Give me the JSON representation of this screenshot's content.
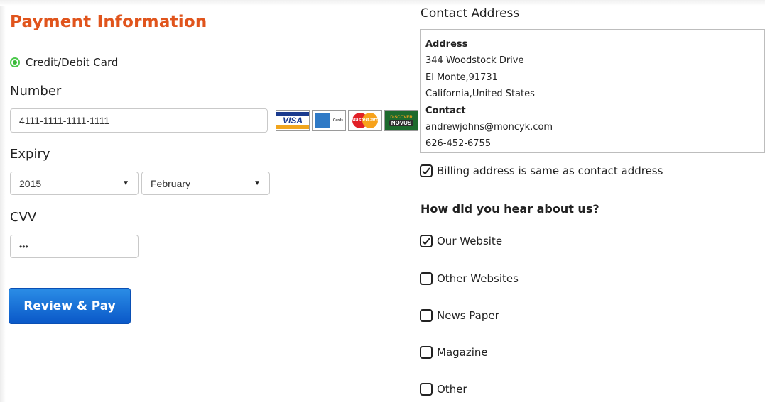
{
  "payment": {
    "title": "Payment Information",
    "method_label": "Credit/Debit Card",
    "number_label": "Number",
    "number_value": "4111-1111-1111-1111",
    "expiry_label": "Expiry",
    "expiry_year": "2015",
    "expiry_month": "February",
    "cvv_label": "CVV",
    "cvv_value": "•••",
    "submit_label": "Review & Pay",
    "card_logos": {
      "visa": "VISA",
      "mastercard": "MasterCard",
      "discover_top": "DISCOVER",
      "discover_bottom": "NOVUS",
      "amex_small": "Cards"
    }
  },
  "contact": {
    "title": "Contact Address",
    "address_heading": "Address",
    "address_lines": [
      "344 Woodstock Drive",
      "El Monte,91731",
      "California,United States"
    ],
    "contact_heading": "Contact",
    "email": "andrewjohns@moncyk.com",
    "phone": "626-452-6755"
  },
  "billing_same": {
    "label": "Billing address is same as contact address",
    "checked": true
  },
  "survey": {
    "question": "How did you hear about us?",
    "options": [
      {
        "label": "Our Website",
        "checked": true
      },
      {
        "label": "Other Websites",
        "checked": false
      },
      {
        "label": "News Paper",
        "checked": false
      },
      {
        "label": "Magazine",
        "checked": false
      },
      {
        "label": "Other",
        "checked": false
      }
    ]
  },
  "colors": {
    "title_orange": "#e0541c",
    "radio_green": "#3ab83a",
    "button_blue": "#0a58c8"
  },
  "icons": [
    "radio-selected-icon",
    "chevron-down-icon",
    "checkmark-icon",
    "visa-logo-icon",
    "amex-logo-icon",
    "mastercard-logo-icon",
    "discover-logo-icon"
  ]
}
